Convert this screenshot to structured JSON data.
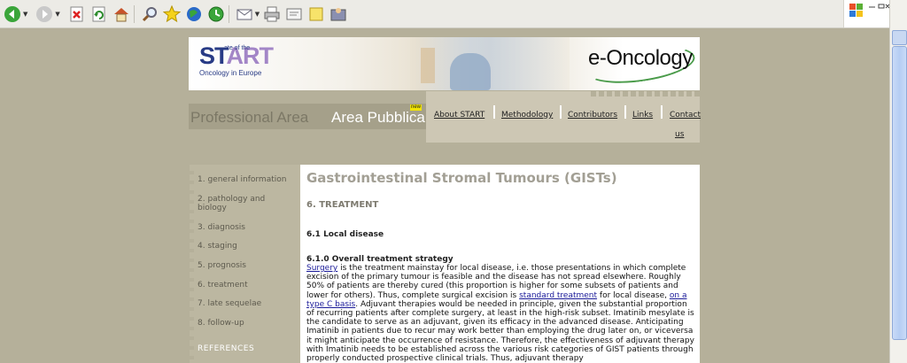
{
  "toolbar": {
    "buttons": [
      "back-icon",
      "forward-icon",
      "stop-icon",
      "refresh-icon",
      "home-icon",
      "search-icon",
      "favorites-icon",
      "media-icon",
      "history-icon",
      "mail-icon",
      "print-icon",
      "edit-icon",
      "discuss-icon",
      "messenger-icon"
    ]
  },
  "banner": {
    "logo_st": "ST",
    "logo_art": "ART",
    "logo_state": "ate of the",
    "logo_sub": "Oncology in Europe",
    "eoncology": "e-Oncology"
  },
  "area": {
    "professional": "Professional Area",
    "public": "Area Pubblica",
    "new_badge": "new"
  },
  "nav": {
    "about": "About START",
    "methodology": "Methodology",
    "contributors": "Contributors",
    "links": "Links",
    "contact_1": "Contact",
    "contact_2": "us"
  },
  "sidebar": {
    "items": [
      {
        "l1": "1. general information",
        "l2": ""
      },
      {
        "l1": "2. pathology and",
        "l2": "biology"
      },
      {
        "l1": "3. diagnosis",
        "l2": ""
      },
      {
        "l1": "4. staging",
        "l2": ""
      },
      {
        "l1": "5. prognosis",
        "l2": ""
      },
      {
        "l1": "6. treatment",
        "l2": ""
      },
      {
        "l1": "7. late sequelae",
        "l2": ""
      },
      {
        "l1": "8. follow-up",
        "l2": ""
      }
    ],
    "references": "REFERENCES"
  },
  "content": {
    "title": "Gastrointestinal Stromal Tumours (GISTs)",
    "section": "6. TREATMENT",
    "subsection": "6.1 Local disease",
    "subsubsection": "6.1.0 Overall treatment strategy",
    "link_surgery": "Surgery",
    "t1": " is the treatment mainstay for local disease, i.e. those presentations in which complete excision of the primary tumour is feasible and the disease has not spread elsewhere. Roughly 50% of patients are thereby cured (this proportion is higher for some subsets of patients and lower for others). Thus, complete surgical excision is ",
    "link_standard": "standard treatment",
    "t2": " for local disease, ",
    "link_typec": "on a type C basis",
    "t3": ". Adjuvant therapies would be needed in principle, given the substantial proportion of recurring patients after complete surgery, at least in the high-risk subset. Imatinib mesylate is the candidate to serve as an adjuvant, given its efficacy in the advanced disease. Anticipating Imatinib in patients due to recur may work better than employing the drug later on, or viceversa it might anticipate the occurrence of resistance. Therefore, the effectiveness of adjuvant therapy with Imatinib needs to be established across the various risk categories of GIST patients through properly conducted prospective clinical trials. Thus, adjuvant therapy"
  }
}
